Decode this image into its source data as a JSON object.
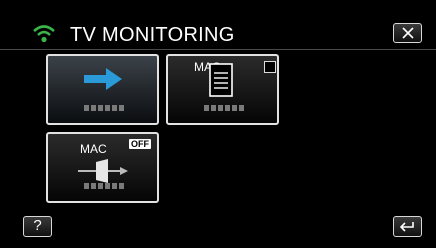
{
  "header": {
    "title": "TV MONITORING",
    "wifi_icon": "wifi-icon",
    "close_icon": "close-icon"
  },
  "tiles": [
    {
      "id": "tv-output",
      "icon": "right-arrow-icon"
    },
    {
      "id": "mac-list",
      "label": "MAC",
      "icon": "document-icon",
      "checkbox": "checkbox-icon"
    },
    {
      "id": "mac-filter",
      "label": "MAC",
      "badge": "OFF",
      "icon": "screen-arrow-icon"
    }
  ],
  "footer": {
    "help_label": "?",
    "back_icon": "back-arrow-icon"
  },
  "colors": {
    "accent": "#2a9ad8",
    "wifi": "#39b54a",
    "placeholder": "#7a7a7a"
  }
}
